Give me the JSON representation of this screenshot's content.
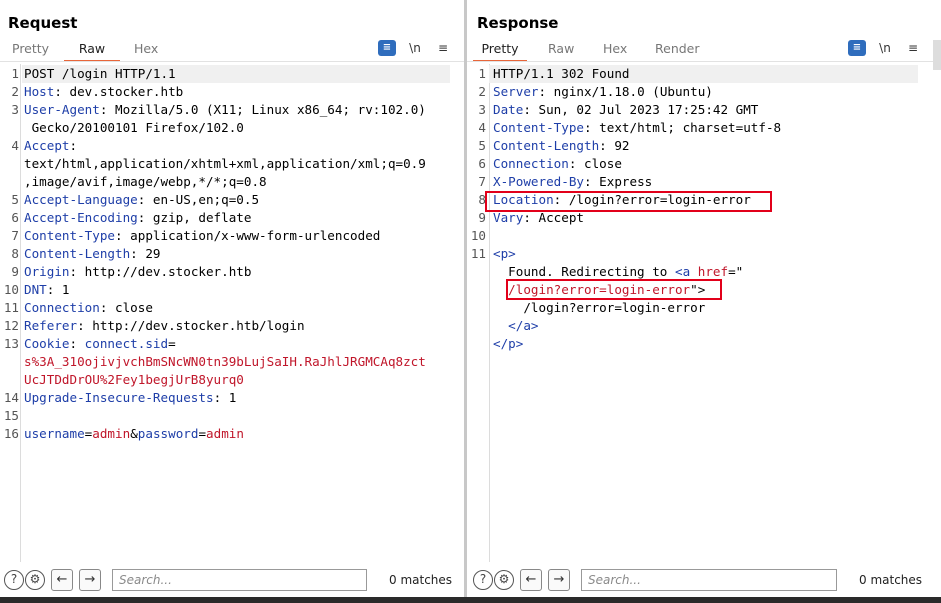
{
  "request": {
    "title": "Request",
    "tabs": [
      {
        "label": "Pretty",
        "active": false
      },
      {
        "label": "Raw",
        "active": true
      },
      {
        "label": "Hex",
        "active": false
      }
    ],
    "tools": {
      "wrap": "≡",
      "newline": "\\n",
      "menu": "≡"
    },
    "lines": [
      {
        "n": "1",
        "parts": [
          {
            "t": "POST /login HTTP/1.1",
            "c": "val"
          }
        ]
      },
      {
        "n": "2",
        "parts": [
          {
            "t": "Host",
            "c": "key"
          },
          {
            "t": ": dev.stocker.htb",
            "c": "val"
          }
        ]
      },
      {
        "n": "3",
        "parts": [
          {
            "t": "User-Agent",
            "c": "key"
          },
          {
            "t": ": Mozilla/5.0 (X11; Linux x86_64; rv:102.0)",
            "c": "val"
          }
        ]
      },
      {
        "n": "",
        "parts": [
          {
            "t": " Gecko/20100101 Firefox/102.0",
            "c": "val"
          }
        ]
      },
      {
        "n": "4",
        "parts": [
          {
            "t": "Accept",
            "c": "key"
          },
          {
            "t": ":",
            "c": "val"
          }
        ]
      },
      {
        "n": "",
        "parts": [
          {
            "t": "text/html,application/xhtml+xml,application/xml;q=0.9",
            "c": "val"
          }
        ]
      },
      {
        "n": "",
        "parts": [
          {
            "t": ",image/avif,image/webp,*/*;q=0.8",
            "c": "val"
          }
        ]
      },
      {
        "n": "5",
        "parts": [
          {
            "t": "Accept-Language",
            "c": "key"
          },
          {
            "t": ": en-US,en;q=0.5",
            "c": "val"
          }
        ]
      },
      {
        "n": "6",
        "parts": [
          {
            "t": "Accept-Encoding",
            "c": "key"
          },
          {
            "t": ": gzip, deflate",
            "c": "val"
          }
        ]
      },
      {
        "n": "7",
        "parts": [
          {
            "t": "Content-Type",
            "c": "key"
          },
          {
            "t": ": application/x-www-form-urlencoded",
            "c": "val"
          }
        ]
      },
      {
        "n": "8",
        "parts": [
          {
            "t": "Content-Length",
            "c": "key"
          },
          {
            "t": ": 29",
            "c": "val"
          }
        ]
      },
      {
        "n": "9",
        "parts": [
          {
            "t": "Origin",
            "c": "key"
          },
          {
            "t": ": http://dev.stocker.htb",
            "c": "val"
          }
        ]
      },
      {
        "n": "10",
        "parts": [
          {
            "t": "DNT",
            "c": "key"
          },
          {
            "t": ": 1",
            "c": "val"
          }
        ]
      },
      {
        "n": "11",
        "parts": [
          {
            "t": "Connection",
            "c": "key"
          },
          {
            "t": ": close",
            "c": "val"
          }
        ]
      },
      {
        "n": "12",
        "parts": [
          {
            "t": "Referer",
            "c": "key"
          },
          {
            "t": ": http://dev.stocker.htb/login",
            "c": "val"
          }
        ]
      },
      {
        "n": "13",
        "parts": [
          {
            "t": "Cookie",
            "c": "key"
          },
          {
            "t": ": ",
            "c": "val"
          },
          {
            "t": "connect.sid",
            "c": "key"
          },
          {
            "t": "=",
            "c": "val"
          }
        ]
      },
      {
        "n": "",
        "parts": [
          {
            "t": "s%3A_310ojivjvchBmSNcWN0tn39bLujSaIH.RaJhlJRGMCAq8zct",
            "c": "red"
          }
        ]
      },
      {
        "n": "",
        "parts": [
          {
            "t": "UcJTDdDrOU%2Fey1begjUrB8yurq0",
            "c": "red"
          }
        ]
      },
      {
        "n": "14",
        "parts": [
          {
            "t": "Upgrade-Insecure-Requests",
            "c": "key"
          },
          {
            "t": ": 1",
            "c": "val"
          }
        ]
      },
      {
        "n": "15",
        "parts": []
      },
      {
        "n": "16",
        "parts": [
          {
            "t": "username",
            "c": "key"
          },
          {
            "t": "=",
            "c": "val"
          },
          {
            "t": "admin",
            "c": "red"
          },
          {
            "t": "&",
            "c": "val"
          },
          {
            "t": "password",
            "c": "key"
          },
          {
            "t": "=",
            "c": "val"
          },
          {
            "t": "admin",
            "c": "red"
          }
        ]
      }
    ],
    "search_placeholder": "Search...",
    "matches": "0 matches"
  },
  "response": {
    "title": "Response",
    "tabs": [
      {
        "label": "Pretty",
        "active": true
      },
      {
        "label": "Raw",
        "active": false
      },
      {
        "label": "Hex",
        "active": false
      },
      {
        "label": "Render",
        "active": false
      }
    ],
    "tools": {
      "wrap": "≡",
      "newline": "\\n",
      "menu": "≡"
    },
    "lines": [
      {
        "n": "1",
        "parts": [
          {
            "t": "HTTP/1.1 302 Found",
            "c": "val"
          }
        ]
      },
      {
        "n": "2",
        "parts": [
          {
            "t": "Server",
            "c": "key"
          },
          {
            "t": ": nginx/1.18.0 (Ubuntu)",
            "c": "val"
          }
        ]
      },
      {
        "n": "3",
        "parts": [
          {
            "t": "Date",
            "c": "key"
          },
          {
            "t": ": Sun, 02 Jul 2023 17:25:42 GMT",
            "c": "val"
          }
        ]
      },
      {
        "n": "4",
        "parts": [
          {
            "t": "Content-Type",
            "c": "key"
          },
          {
            "t": ": text/html; charset=utf-8",
            "c": "val"
          }
        ]
      },
      {
        "n": "5",
        "parts": [
          {
            "t": "Content-Length",
            "c": "key"
          },
          {
            "t": ": 92",
            "c": "val"
          }
        ]
      },
      {
        "n": "6",
        "parts": [
          {
            "t": "Connection",
            "c": "key"
          },
          {
            "t": ": close",
            "c": "val"
          }
        ]
      },
      {
        "n": "7",
        "parts": [
          {
            "t": "X-Powered-By",
            "c": "key"
          },
          {
            "t": ": Express",
            "c": "val"
          }
        ]
      },
      {
        "n": "8",
        "parts": [
          {
            "t": "Location",
            "c": "key"
          },
          {
            "t": ": /login?error=login-error",
            "c": "val"
          }
        ]
      },
      {
        "n": "9",
        "parts": [
          {
            "t": "Vary",
            "c": "key"
          },
          {
            "t": ": Accept",
            "c": "val"
          }
        ]
      },
      {
        "n": "10",
        "parts": []
      },
      {
        "n": "11",
        "parts": [
          {
            "t": "<p>",
            "c": "tag"
          }
        ]
      },
      {
        "n": "",
        "parts": [
          {
            "t": "  Found. Redirecting to ",
            "c": "val"
          },
          {
            "t": "<a ",
            "c": "tag"
          },
          {
            "t": "href",
            "c": "red"
          },
          {
            "t": "=\"",
            "c": "val"
          }
        ]
      },
      {
        "n": "",
        "parts": [
          {
            "t": "  /login?error=login-error",
            "c": "red"
          },
          {
            "t": "\">",
            "c": "val"
          }
        ]
      },
      {
        "n": "",
        "parts": [
          {
            "t": "    /login?error=login-error",
            "c": "val"
          }
        ]
      },
      {
        "n": "",
        "parts": [
          {
            "t": "  </a>",
            "c": "tag"
          }
        ]
      },
      {
        "n": "",
        "parts": [
          {
            "t": "</p>",
            "c": "tag"
          }
        ]
      }
    ],
    "search_placeholder": "Search...",
    "matches": "0 matches"
  },
  "colors": {
    "accent": "#e8663a",
    "highlight_box": "#e2001a",
    "key": "#1e3ea8",
    "value_red": "#c0162a",
    "layout_active": "#2f6dbd"
  }
}
